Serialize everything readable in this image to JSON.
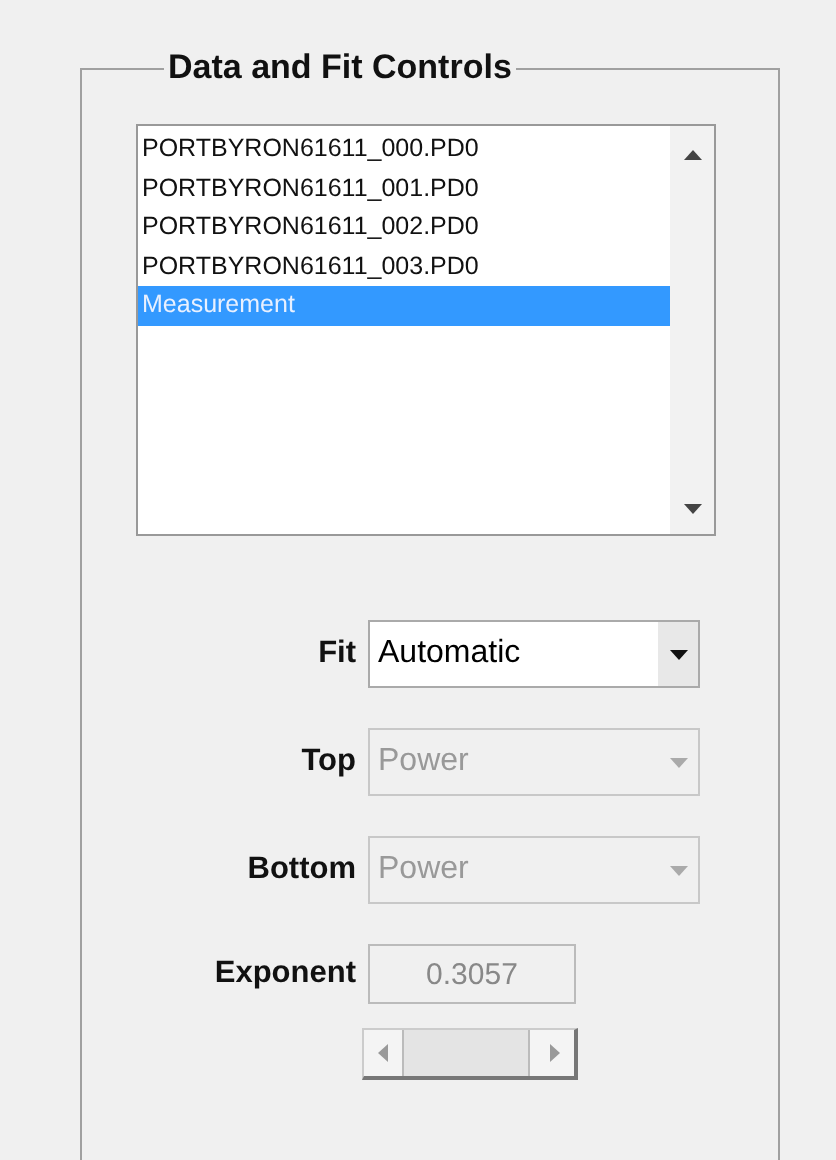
{
  "panel": {
    "title": "Data and Fit Controls"
  },
  "files": [
    {
      "label": "PORTBYRON61611_000.PD0",
      "selected": false
    },
    {
      "label": "PORTBYRON61611_001.PD0",
      "selected": false
    },
    {
      "label": "PORTBYRON61611_002.PD0",
      "selected": false
    },
    {
      "label": "PORTBYRON61611_003.PD0",
      "selected": false
    },
    {
      "label": "Measurement",
      "selected": true
    }
  ],
  "controls": [
    {
      "kind": "dropdown",
      "label": "Fit",
      "value": "Automatic",
      "disabled": false
    },
    {
      "kind": "dropdown",
      "label": "Top",
      "value": "Power",
      "disabled": true
    },
    {
      "kind": "dropdown",
      "label": "Bottom",
      "value": "Power",
      "disabled": true
    },
    {
      "kind": "field",
      "label": "Exponent",
      "value": "0.3057",
      "disabled": true
    }
  ]
}
